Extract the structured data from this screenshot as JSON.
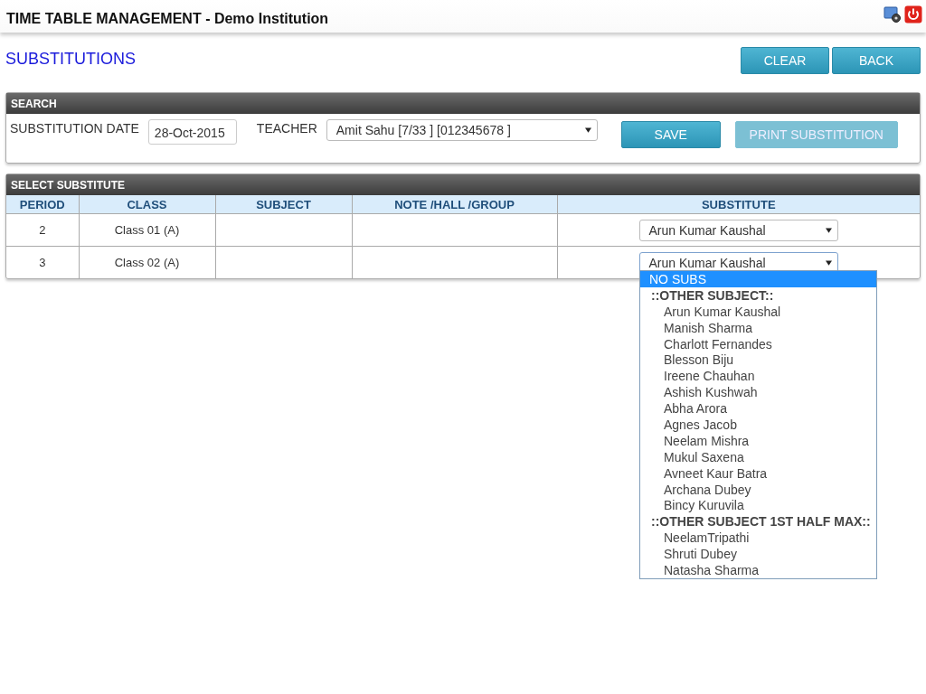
{
  "header": {
    "title": "TIME TABLE MANAGEMENT - Demo Institution"
  },
  "page_title": "SUBSTITUTIONS",
  "top_buttons": [
    {
      "label": "CLEAR",
      "disabled": false
    },
    {
      "label": "BACK",
      "disabled": false
    }
  ],
  "search": {
    "title": "SEARCH",
    "date_label": "SUBSTITUTION DATE",
    "date_value": "28-Oct-2015",
    "teacher_label": "TEACHER",
    "teacher_value": "Amit Sahu [7/33 ] [012345678 ]",
    "buttons": [
      {
        "label": "SAVE",
        "disabled": false
      },
      {
        "label": "PRINT SUBSTITUTION",
        "disabled": true
      }
    ]
  },
  "substitute": {
    "title": "SELECT SUBSTITUTE",
    "columns": [
      "PERIOD",
      "CLASS",
      "SUBJECT",
      "NOTE /HALL /GROUP",
      "SUBSTITUTE"
    ],
    "rows": [
      {
        "period": "2",
        "class": "Class 01 (A)",
        "substitute": "Arun Kumar Kaushal",
        "focused": false
      },
      {
        "period": "3",
        "class": "Class 02 (A)",
        "substitute": "Arun Kumar Kaushal",
        "focused": true
      }
    ]
  },
  "dropdown": {
    "options": [
      {
        "kind": "option",
        "label": "NO SUBS",
        "selected": true
      },
      {
        "kind": "group",
        "label": "::OTHER SUBJECT::"
      },
      {
        "kind": "option",
        "label": "Arun Kumar Kaushal",
        "selected": false
      },
      {
        "kind": "option",
        "label": "Manish Sharma",
        "selected": false
      },
      {
        "kind": "option",
        "label": "Charlott Fernandes",
        "selected": false
      },
      {
        "kind": "option",
        "label": "Blesson Biju",
        "selected": false
      },
      {
        "kind": "option",
        "label": "Ireene Chauhan",
        "selected": false
      },
      {
        "kind": "option",
        "label": "Ashish Kushwah",
        "selected": false
      },
      {
        "kind": "option",
        "label": "Abha Arora",
        "selected": false
      },
      {
        "kind": "option",
        "label": "Agnes Jacob",
        "selected": false
      },
      {
        "kind": "option",
        "label": "Neelam Mishra",
        "selected": false
      },
      {
        "kind": "option",
        "label": "Mukul Saxena",
        "selected": false
      },
      {
        "kind": "option",
        "label": "Avneet Kaur Batra",
        "selected": false
      },
      {
        "kind": "option",
        "label": "Archana Dubey",
        "selected": false
      },
      {
        "kind": "option",
        "label": "Bincy Kuruvila",
        "selected": false
      },
      {
        "kind": "group",
        "label": "::OTHER SUBJECT 1ST HALF MAX::"
      },
      {
        "kind": "option",
        "label": "NeelamTripathi",
        "selected": false
      },
      {
        "kind": "option",
        "label": "Shruti Dubey",
        "selected": false
      },
      {
        "kind": "option",
        "label": "Natasha Sharma",
        "selected": false
      }
    ]
  }
}
